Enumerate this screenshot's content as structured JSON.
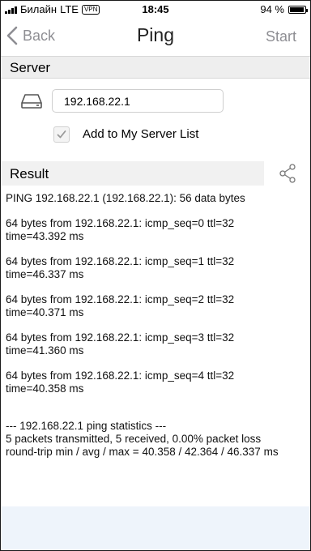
{
  "status_bar": {
    "carrier": "Билайн",
    "network": "LTE",
    "vpn": "VPN",
    "time": "18:45",
    "battery": "94 %",
    "battery_level": 0.94
  },
  "nav": {
    "back_label": "Back",
    "title": "Ping",
    "start_label": "Start"
  },
  "server_section": {
    "header": "Server",
    "host_value": "192.168.22.1",
    "add_to_list_label": "Add to My Server List",
    "add_to_list_checked": true
  },
  "result_section": {
    "header": "Result",
    "intro": "PING 192.168.22.1 (192.168.22.1): 56 data bytes",
    "replies": [
      {
        "line1": "64 bytes from 192.168.22.1: icmp_seq=0 ttl=32",
        "line2": "time=43.392 ms"
      },
      {
        "line1": "64 bytes from 192.168.22.1: icmp_seq=1 ttl=32",
        "line2": "time=46.337 ms"
      },
      {
        "line1": "64 bytes from 192.168.22.1: icmp_seq=2 ttl=32",
        "line2": "time=40.371 ms"
      },
      {
        "line1": "64 bytes from 192.168.22.1: icmp_seq=3 ttl=32",
        "line2": "time=41.360 ms"
      },
      {
        "line1": "64 bytes from 192.168.22.1: icmp_seq=4 ttl=32",
        "line2": "time=40.358 ms"
      }
    ],
    "stats_header": "--- 192.168.22.1 ping statistics ---",
    "stats_packets": "5 packets transmitted, 5 received, 0.00% packet loss",
    "stats_rtt": "round-trip  min / avg / max = 40.358 / 42.364 / 46.337 ms"
  },
  "icons": [
    "back-chevron-icon",
    "drive-icon",
    "checkmark-icon",
    "share-icon",
    "signal-icon",
    "battery-icon"
  ],
  "colors": {
    "nav_gray": "#8e8e93",
    "section_bg": "#eeeeee",
    "bottom_band": "#eef4fb"
  }
}
